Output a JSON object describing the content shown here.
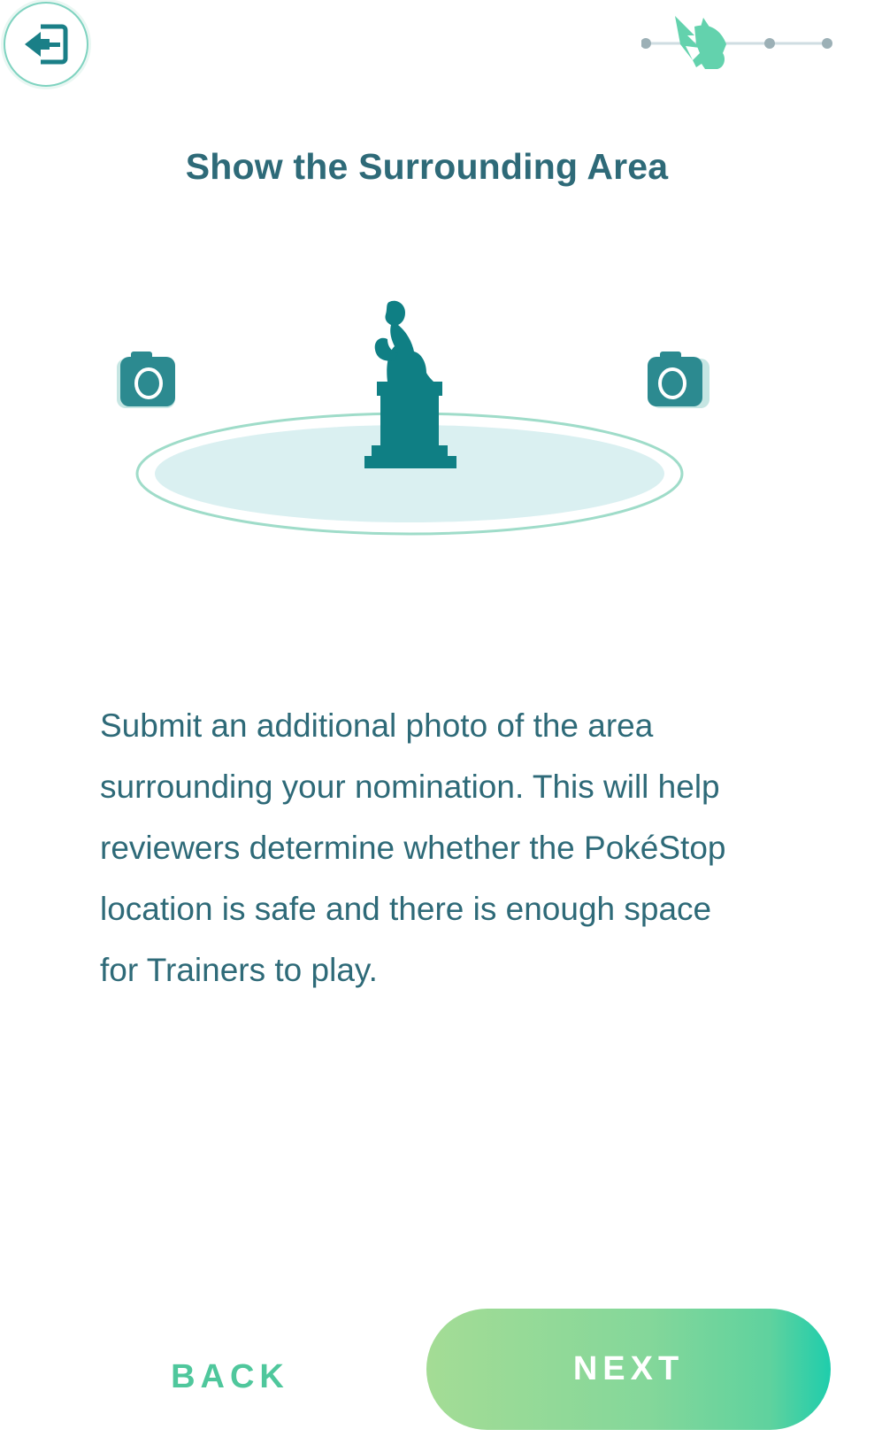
{
  "header": {
    "exit_icon": "exit-door-icon",
    "progress_icon": "pokemon-silhouette-icon"
  },
  "title": "Show the Surrounding Area",
  "illustration": {
    "statue_icon": "statue-icon",
    "camera_icon": "camera-icon"
  },
  "description": "Submit an additional photo of the area surrounding your nomination. This will help reviewers determine whether the PokéStop location is safe and there is enough space for Trainers to play.",
  "footer": {
    "back_label": "BACK",
    "next_label": "NEXT"
  },
  "colors": {
    "text_primary": "#2e6a78",
    "accent_green": "#4fc79c",
    "statue": "#0f7f84",
    "area_fill": "#daf0f1"
  }
}
